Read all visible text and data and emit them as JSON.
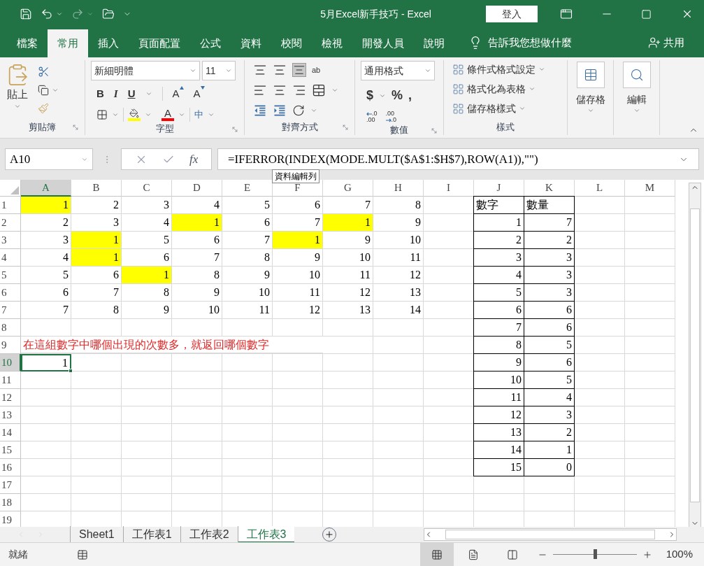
{
  "title_bar": {
    "title": "5月Excel新手技巧  -  Excel",
    "sign_in": "登入"
  },
  "menu_tabs": [
    {
      "label": "檔案",
      "selected": false
    },
    {
      "label": "常用",
      "selected": true
    },
    {
      "label": "插入",
      "selected": false
    },
    {
      "label": "頁面配置",
      "selected": false
    },
    {
      "label": "公式",
      "selected": false
    },
    {
      "label": "資料",
      "selected": false
    },
    {
      "label": "校閱",
      "selected": false
    },
    {
      "label": "檢視",
      "selected": false
    },
    {
      "label": "開發人員",
      "selected": false
    },
    {
      "label": "說明",
      "selected": false
    }
  ],
  "tell_me": "告訴我您想做什麼",
  "share": "共用",
  "ribbon": {
    "clipboard": {
      "label": "剪貼簿",
      "paste": "貼上"
    },
    "font": {
      "label": "字型",
      "font_name": "新細明體",
      "font_size": "11",
      "style_buttons": [
        "B",
        "I",
        "U"
      ],
      "grow": "A",
      "shrink": "A",
      "font_color": "A",
      "phonetic": "中"
    },
    "alignment": {
      "label": "對齊方式",
      "wrap": "ab"
    },
    "number": {
      "label": "數值",
      "format": "通用格式",
      "buttons": [
        "$",
        "%",
        ","
      ],
      "decimals": [
        [
          ".0",
          ".00"
        ],
        [
          ".00",
          ".0"
        ]
      ]
    },
    "styles": {
      "label": "樣式",
      "items": [
        "條件式格式設定",
        "格式化為表格",
        "儲存格樣式"
      ]
    },
    "cells": {
      "label": "儲存格"
    },
    "editing": {
      "label": "編輯"
    }
  },
  "formula_bar": {
    "name_box": "A10",
    "fx": "fx",
    "formula": "=IFERROR(INDEX(MODE.MULT($A$1:$H$7),ROW(A1)),\"\")",
    "tooltip": "資料編輯列"
  },
  "sheet": {
    "columns": [
      {
        "label": "A",
        "selected": true
      },
      {
        "label": "B",
        "selected": false
      },
      {
        "label": "C",
        "selected": false
      },
      {
        "label": "D",
        "selected": false
      },
      {
        "label": "E",
        "selected": false
      },
      {
        "label": "F",
        "selected": false
      },
      {
        "label": "G",
        "selected": false
      },
      {
        "label": "H",
        "selected": false
      },
      {
        "label": "I",
        "selected": false
      },
      {
        "label": "J",
        "selected": false
      },
      {
        "label": "K",
        "selected": false
      },
      {
        "label": "L",
        "selected": false
      },
      {
        "label": "M",
        "selected": false
      }
    ],
    "rows": [
      {
        "label": "1",
        "selected": false,
        "cells": [
          {
            "text": "1",
            "highlighted": true
          },
          {
            "text": "2",
            "highlighted": false
          },
          {
            "text": "3",
            "highlighted": false
          },
          {
            "text": "4",
            "highlighted": false
          },
          {
            "text": "5",
            "highlighted": false
          },
          {
            "text": "6",
            "highlighted": false
          },
          {
            "text": "7",
            "highlighted": false
          },
          {
            "text": "8",
            "highlighted": false
          },
          null,
          {
            "text": "數字",
            "kind": "text"
          },
          {
            "text": "數量",
            "kind": "text"
          }
        ]
      },
      {
        "label": "2",
        "selected": false,
        "cells": [
          {
            "text": "2",
            "highlighted": false
          },
          {
            "text": "3",
            "highlighted": false
          },
          {
            "text": "4",
            "highlighted": false
          },
          {
            "text": "1",
            "highlighted": true
          },
          {
            "text": "6",
            "highlighted": false
          },
          {
            "text": "7",
            "highlighted": false
          },
          {
            "text": "1",
            "highlighted": true
          },
          {
            "text": "9",
            "highlighted": false
          },
          null,
          {
            "text": "1"
          },
          {
            "text": "7"
          }
        ]
      },
      {
        "label": "3",
        "selected": false,
        "cells": [
          {
            "text": "3",
            "highlighted": false
          },
          {
            "text": "1",
            "highlighted": true
          },
          {
            "text": "5",
            "highlighted": false
          },
          {
            "text": "6",
            "highlighted": false
          },
          {
            "text": "7",
            "highlighted": false
          },
          {
            "text": "1",
            "highlighted": true
          },
          {
            "text": "9",
            "highlighted": false
          },
          {
            "text": "10",
            "highlighted": false
          },
          null,
          {
            "text": "2"
          },
          {
            "text": "2"
          }
        ]
      },
      {
        "label": "4",
        "selected": false,
        "cells": [
          {
            "text": "4",
            "highlighted": false
          },
          {
            "text": "1",
            "highlighted": true
          },
          {
            "text": "6",
            "highlighted": false
          },
          {
            "text": "7",
            "highlighted": false
          },
          {
            "text": "8",
            "highlighted": false
          },
          {
            "text": "9",
            "highlighted": false
          },
          {
            "text": "10",
            "highlighted": false
          },
          {
            "text": "11",
            "highlighted": false
          },
          null,
          {
            "text": "3"
          },
          {
            "text": "3"
          }
        ]
      },
      {
        "label": "5",
        "selected": false,
        "cells": [
          {
            "text": "5",
            "highlighted": false
          },
          {
            "text": "6",
            "highlighted": false
          },
          {
            "text": "1",
            "highlighted": true
          },
          {
            "text": "8",
            "highlighted": false
          },
          {
            "text": "9",
            "highlighted": false
          },
          {
            "text": "10",
            "highlighted": false
          },
          {
            "text": "11",
            "highlighted": false
          },
          {
            "text": "12",
            "highlighted": false
          },
          null,
          {
            "text": "4"
          },
          {
            "text": "3"
          }
        ]
      },
      {
        "label": "6",
        "selected": false,
        "cells": [
          {
            "text": "6",
            "highlighted": false
          },
          {
            "text": "7",
            "highlighted": false
          },
          {
            "text": "8",
            "highlighted": false
          },
          {
            "text": "9",
            "highlighted": false
          },
          {
            "text": "10",
            "highlighted": false
          },
          {
            "text": "11",
            "highlighted": false
          },
          {
            "text": "12",
            "highlighted": false
          },
          {
            "text": "13",
            "highlighted": false
          },
          null,
          {
            "text": "5"
          },
          {
            "text": "3"
          }
        ]
      },
      {
        "label": "7",
        "selected": false,
        "cells": [
          {
            "text": "7",
            "highlighted": false
          },
          {
            "text": "8",
            "highlighted": false
          },
          {
            "text": "9",
            "highlighted": false
          },
          {
            "text": "10",
            "highlighted": false
          },
          {
            "text": "11",
            "highlighted": false
          },
          {
            "text": "12",
            "highlighted": false
          },
          {
            "text": "13",
            "highlighted": false
          },
          {
            "text": "14",
            "highlighted": false
          },
          null,
          {
            "text": "6"
          },
          {
            "text": "6"
          }
        ]
      },
      {
        "label": "8",
        "selected": false,
        "cells": [
          null,
          null,
          null,
          null,
          null,
          null,
          null,
          null,
          null,
          {
            "text": "7"
          },
          {
            "text": "6"
          }
        ]
      },
      {
        "label": "9",
        "selected": false,
        "cells": [
          {
            "text": "在這組數字中哪個出現的次數多，就返回哪個數字",
            "kind": "note"
          },
          null,
          null,
          null,
          null,
          null,
          null,
          null,
          null,
          {
            "text": "8"
          },
          {
            "text": "5"
          }
        ]
      },
      {
        "label": "10",
        "selected": true,
        "cells": [
          {
            "text": "1"
          },
          null,
          null,
          null,
          null,
          null,
          null,
          null,
          null,
          {
            "text": "9"
          },
          {
            "text": "6"
          }
        ]
      },
      {
        "label": "11",
        "selected": false,
        "cells": [
          null,
          null,
          null,
          null,
          null,
          null,
          null,
          null,
          null,
          {
            "text": "10"
          },
          {
            "text": "5"
          }
        ]
      },
      {
        "label": "12",
        "selected": false,
        "cells": [
          null,
          null,
          null,
          null,
          null,
          null,
          null,
          null,
          null,
          {
            "text": "11"
          },
          {
            "text": "4"
          }
        ]
      },
      {
        "label": "13",
        "selected": false,
        "cells": [
          null,
          null,
          null,
          null,
          null,
          null,
          null,
          null,
          null,
          {
            "text": "12"
          },
          {
            "text": "3"
          }
        ]
      },
      {
        "label": "14",
        "selected": false,
        "cells": [
          null,
          null,
          null,
          null,
          null,
          null,
          null,
          null,
          null,
          {
            "text": "13"
          },
          {
            "text": "2"
          }
        ]
      },
      {
        "label": "15",
        "selected": false,
        "cells": [
          null,
          null,
          null,
          null,
          null,
          null,
          null,
          null,
          null,
          {
            "text": "14"
          },
          {
            "text": "1"
          }
        ]
      },
      {
        "label": "16",
        "selected": false,
        "cells": [
          null,
          null,
          null,
          null,
          null,
          null,
          null,
          null,
          null,
          {
            "text": "15"
          },
          {
            "text": "0"
          }
        ]
      },
      {
        "label": "17",
        "selected": false,
        "cells": []
      },
      {
        "label": "18",
        "selected": false,
        "cells": []
      },
      {
        "label": "19",
        "selected": false,
        "cells": []
      }
    ]
  },
  "sheet_tabs": [
    {
      "label": "Sheet1",
      "selected": false
    },
    {
      "label": "工作表1",
      "selected": false
    },
    {
      "label": "工作表2",
      "selected": false
    },
    {
      "label": "工作表3",
      "selected": true
    }
  ],
  "status_bar": {
    "status": "就緒",
    "zoom": "100%",
    "zoom_slider": {
      "level": 0.5
    }
  }
}
